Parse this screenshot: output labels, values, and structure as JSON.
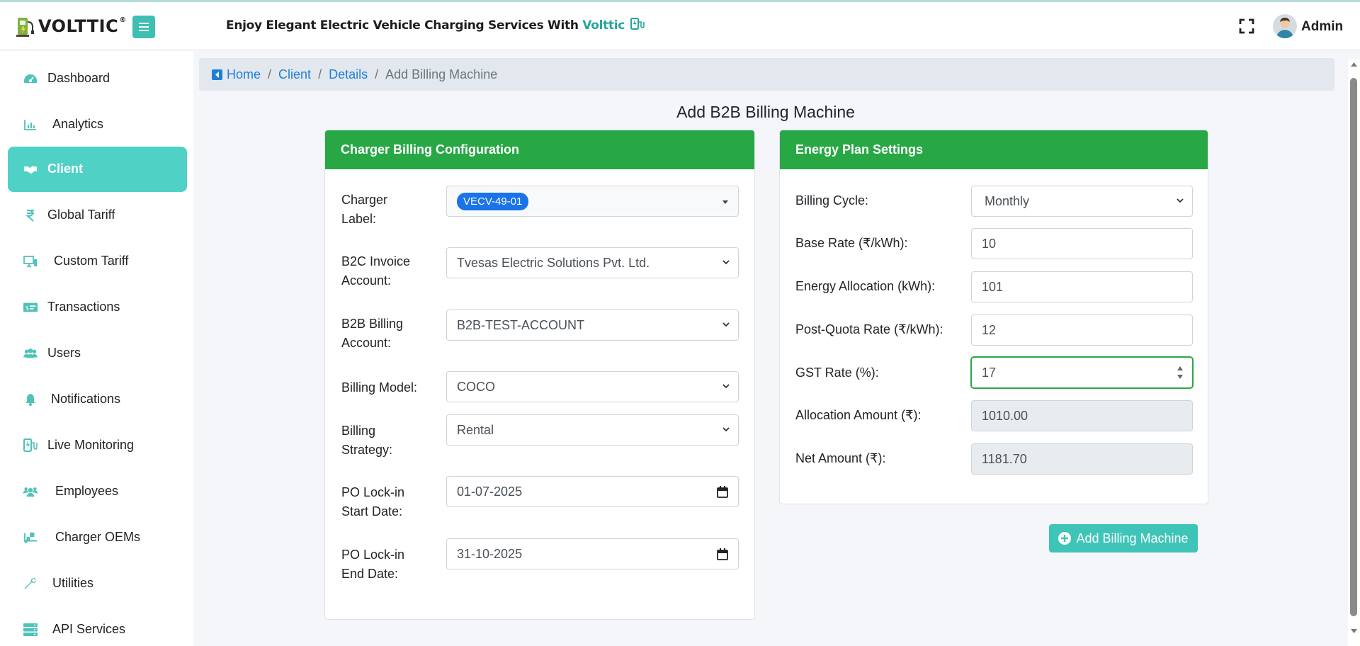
{
  "header": {
    "logo_text": "VOLTTIC",
    "logo_reg": "®",
    "tagline_prefix": "Enjoy Elegant Electric Vehicle Charging Services With ",
    "tagline_brand": "Volttic",
    "user_name": "Admin"
  },
  "sidebar": {
    "items": [
      {
        "label": "Dashboard",
        "icon": "tachometer-icon"
      },
      {
        "label": "Analytics",
        "icon": "bar-chart-icon"
      },
      {
        "label": "Client",
        "icon": "handshake-icon"
      },
      {
        "label": "Global Tariff",
        "icon": "rupee-icon"
      },
      {
        "label": "Custom Tariff",
        "icon": "charger-display-icon"
      },
      {
        "label": "Transactions",
        "icon": "money-bill-icon"
      },
      {
        "label": "Users",
        "icon": "users-icon"
      },
      {
        "label": "Notifications",
        "icon": "bell-icon"
      },
      {
        "label": "Live Monitoring",
        "icon": "charging-station-icon"
      },
      {
        "label": "Employees",
        "icon": "employees-icon"
      },
      {
        "label": "Charger OEMs",
        "icon": "truck-loading-icon"
      },
      {
        "label": "Utilities",
        "icon": "wrench-icon"
      },
      {
        "label": "API Services",
        "icon": "server-icon"
      }
    ],
    "active": "Client"
  },
  "breadcrumb": {
    "home": "Home",
    "client": "Client",
    "details": "Details",
    "current": "Add Billing Machine",
    "sep": "/"
  },
  "page_title": "Add B2B Billing Machine",
  "charger_config": {
    "title": "Charger Billing Configuration",
    "charger_label_l1": "Charger",
    "charger_label_l2": "Label:",
    "charger_label_value": "VECV-49-01",
    "b2c_l1": "B2C Invoice",
    "b2c_l2": "Account:",
    "b2c_value": "Tvesas Electric Solutions Pvt. Ltd.",
    "b2b_l1": "B2B Billing",
    "b2b_l2": "Account:",
    "b2b_value": "B2B-TEST-ACCOUNT",
    "model_label": "Billing Model:",
    "model_value": "COCO",
    "strategy_l1": "Billing",
    "strategy_l2": "Strategy:",
    "strategy_value": "Rental",
    "po_start_l1": "PO Lock-in",
    "po_start_l2": "Start Date:",
    "po_start_value": "01-07-2025",
    "po_end_l1": "PO Lock-in",
    "po_end_l2": "End Date:",
    "po_end_value": "31-10-2025"
  },
  "energy_plan": {
    "title": "Energy Plan Settings",
    "cycle_label": "Billing Cycle:",
    "cycle_value": "Monthly",
    "base_rate_label": "Base Rate (₹/kWh):",
    "base_rate_value": "10",
    "allocation_label": "Energy Allocation (kWh):",
    "allocation_value": "101",
    "post_quota_label": "Post-Quota Rate (₹/kWh):",
    "post_quota_value": "12",
    "gst_label": "GST Rate (%):",
    "gst_value": "17",
    "alloc_amount_label": "Allocation Amount (₹):",
    "alloc_amount_value": "1010.00",
    "net_amount_label": "Net Amount (₹):",
    "net_amount_value": "1181.70"
  },
  "add_button_label": "Add Billing Machine",
  "colors": {
    "accent": "#4fd1c5",
    "card_header": "#28a745",
    "link": "#1e7fdb",
    "tag": "#1a73e8"
  }
}
